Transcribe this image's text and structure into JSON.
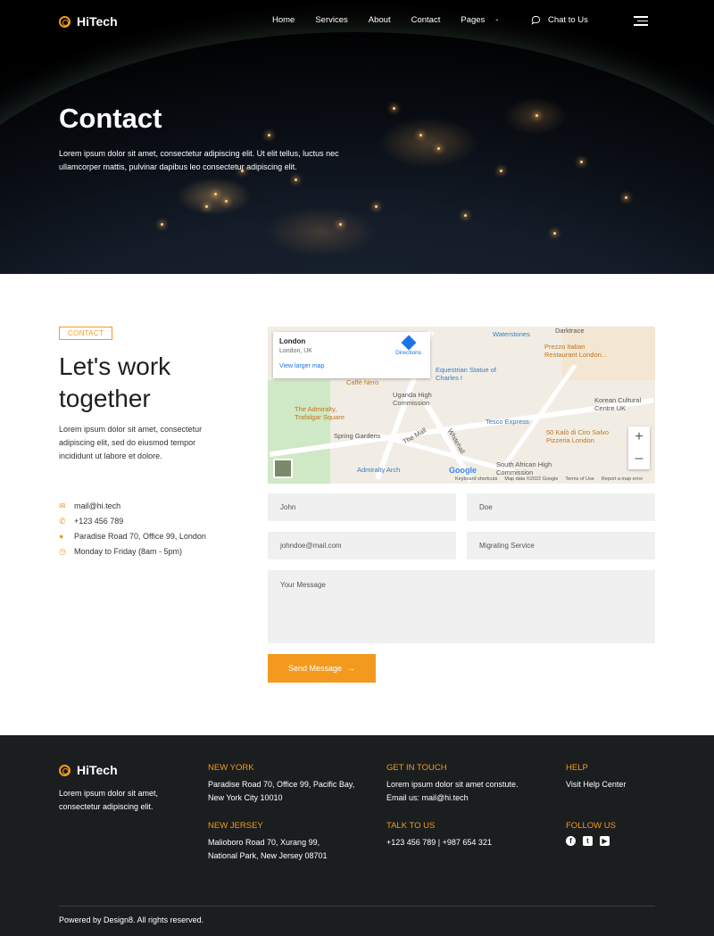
{
  "header": {
    "brand": "HiTech",
    "menu": [
      "Home",
      "Services",
      "About",
      "Contact",
      "Pages"
    ],
    "pages_caret": "-",
    "chat": "Chat to Us"
  },
  "hero": {
    "title": "Contact",
    "text": "Lorem ipsum dolor sit amet, consectetur adipiscing elit. Ut elit tellus, luctus nec ullamcorper mattis, pulvinar dapibus leo consectetur adipiscing elit."
  },
  "contact": {
    "tag": "CONTACT",
    "heading_line1": "Let's work",
    "heading_line2": "together",
    "text": "Lorem ipsum dolor sit amet, consectetur adipiscing elit, sed do eiusmod tempor incididunt ut labore et dolore.",
    "items": [
      {
        "icon": "mail-icon",
        "text": "mail@hi.tech"
      },
      {
        "icon": "phone-icon",
        "text": "+123 456 789"
      },
      {
        "icon": "location-icon",
        "text": "Paradise Road 70, Office 99, London"
      },
      {
        "icon": "clock-icon",
        "text": "Monday to Friday (8am - 5pm)"
      }
    ]
  },
  "map": {
    "place": "London",
    "sub": "London, UK",
    "larger": "View larger map",
    "directions": "Directions",
    "labels": [
      "Waterstones",
      "Prezzo Italian Restaurant London...",
      "Caffè Nero",
      "Equestrian Statue of Charles I",
      "Uganda High Commission",
      "Korean Cultural Centre UK",
      "The Admiralty, Trafalgar Square",
      "Tesco Express",
      "50 Kalò di Ciro Salvo Pizzeria London",
      "The Mall",
      "Whitehall",
      "Spring Gardens",
      "Admiralty Arch",
      "South African High Commission",
      "Darktrace"
    ],
    "footer": [
      "Keyboard shortcuts",
      "Map data ©2022 Google",
      "Terms of Use",
      "Report a map error"
    ],
    "google": "Google"
  },
  "form": {
    "first_name": "John",
    "last_name": "Doe",
    "email": "johndoe@mail.com",
    "service": "Migrating Service",
    "message_placeholder": "Your Message",
    "submit": "Send Message"
  },
  "footer": {
    "brand": "HiTech",
    "desc": "Lorem ipsum dolor sit amet, consectetur adipiscing elit.",
    "ny_title": "NEW YORK",
    "ny_text": "Paradise Road 70, Office 99, Pacific Bay,  New York City 10010",
    "nj_title": "NEW JERSEY",
    "nj_text": "Malioboro Road 70, Xurang 99, National Park, New Jersey 08701",
    "git_title": "GET IN TOUCH",
    "git_text": "Lorem ipsum dolor sit amet constute. Email us: mail@hi.tech",
    "talk_title": "TALK TO US",
    "talk_text": "+123 456 789 | +987 654 321",
    "help_title": "HELP",
    "help_text": "Visit Help Center",
    "follow_title": "FOLLOW US",
    "social": [
      "facebook-icon",
      "twitter-icon",
      "youtube-icon"
    ],
    "copyright": "Powered by Design8. All rights reserved."
  },
  "colors": {
    "accent": "#f39a1e",
    "footer_bg": "#1b1e1f",
    "field_bg": "#f0f0f0"
  }
}
